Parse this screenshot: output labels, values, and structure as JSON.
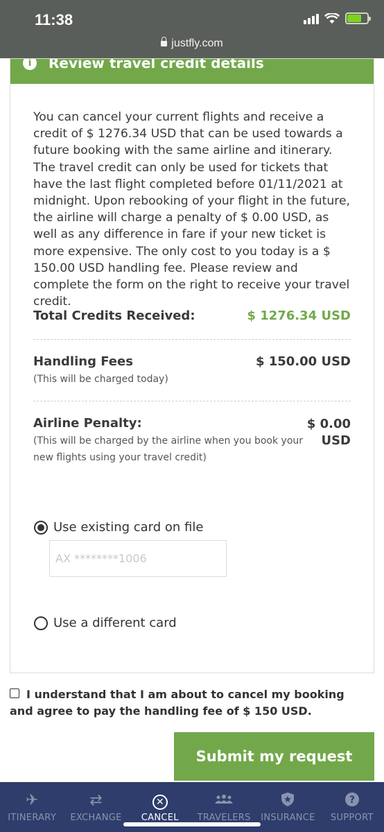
{
  "status_bar": {
    "time": "11:38",
    "url": "justfly.com"
  },
  "card": {
    "header_title": "Review travel credit details",
    "description": "You can cancel your current flights and receive a credit of $ 1276.34 USD that can be used towards a future booking with the same airline and itinerary. The travel credit can only be used for tickets that have the last flight completed before 01/11/2021 at midnight. Upon rebooking of your flight in the future, the airline will charge a penalty of $ 0.00 USD, as well as any difference in fare if your new ticket is more expensive. The only cost to you today is a $ 150.00 USD handling fee. Please review and complete the form on the right to receive your travel credit.",
    "total_credits": {
      "label": "Total Credits Received:",
      "value": "$ 1276.34 USD"
    },
    "handling_fees": {
      "label": "Handling Fees",
      "value": "$ 150.00 USD",
      "note": "(This will be charged today)"
    },
    "airline_penalty": {
      "label": "Airline Penalty:",
      "value_line1": "$ 0.00",
      "value_line2": "USD",
      "note_line1": "(This will be charged by the airline when you book your",
      "note_line2": "new flights using your travel credit)"
    },
    "payment": {
      "existing_label": "Use existing card on file",
      "card_placeholder": "AX ********1006",
      "different_label": "Use a different card"
    }
  },
  "agreement": {
    "text": "I understand that I am about to cancel my booking and agree to pay the handling fee of $ 150 USD."
  },
  "submit_label": "Submit my request",
  "nav": {
    "items": [
      {
        "label": "ITINERARY",
        "icon": "plane-icon"
      },
      {
        "label": "EXCHANGE",
        "icon": "exchange-icon"
      },
      {
        "label": "CANCEL",
        "icon": "cancel-icon"
      },
      {
        "label": "TRAVELERS",
        "icon": "travelers-icon"
      },
      {
        "label": "INSURANCE",
        "icon": "shield-icon"
      },
      {
        "label": "SUPPORT",
        "icon": "help-icon"
      }
    ]
  },
  "colors": {
    "accent_green": "#72a84a",
    "nav_bg": "#2e3d6b",
    "status_bar": "#5a5e5a"
  }
}
